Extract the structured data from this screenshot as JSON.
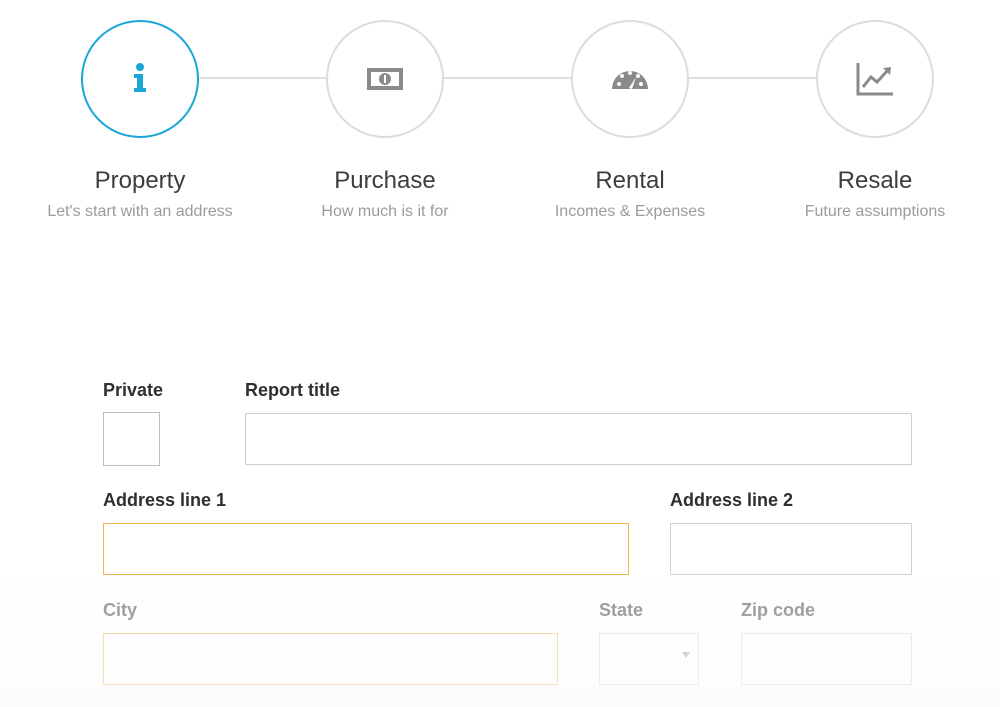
{
  "steps": [
    {
      "title": "Property",
      "subtitle": "Let's start with an address",
      "icon": "info-icon",
      "active": true
    },
    {
      "title": "Purchase",
      "subtitle": "How much is it for",
      "icon": "money-bill-icon",
      "active": false
    },
    {
      "title": "Rental",
      "subtitle": "Incomes & Expenses",
      "icon": "gauge-icon",
      "active": false
    },
    {
      "title": "Resale",
      "subtitle": "Future assumptions",
      "icon": "trend-chart-icon",
      "active": false
    }
  ],
  "form": {
    "private_label": "Private",
    "report_title_label": "Report title",
    "report_title_value": "",
    "address1_label": "Address line 1",
    "address1_value": "",
    "address2_label": "Address line 2",
    "address2_value": "",
    "city_label": "City",
    "city_value": "",
    "state_label": "State",
    "zip_label": "Zip code",
    "zip_value": ""
  },
  "colors": {
    "accent": "#1aa7d8",
    "focus": "#f0b24a",
    "inactive": "#dcdcdc"
  }
}
